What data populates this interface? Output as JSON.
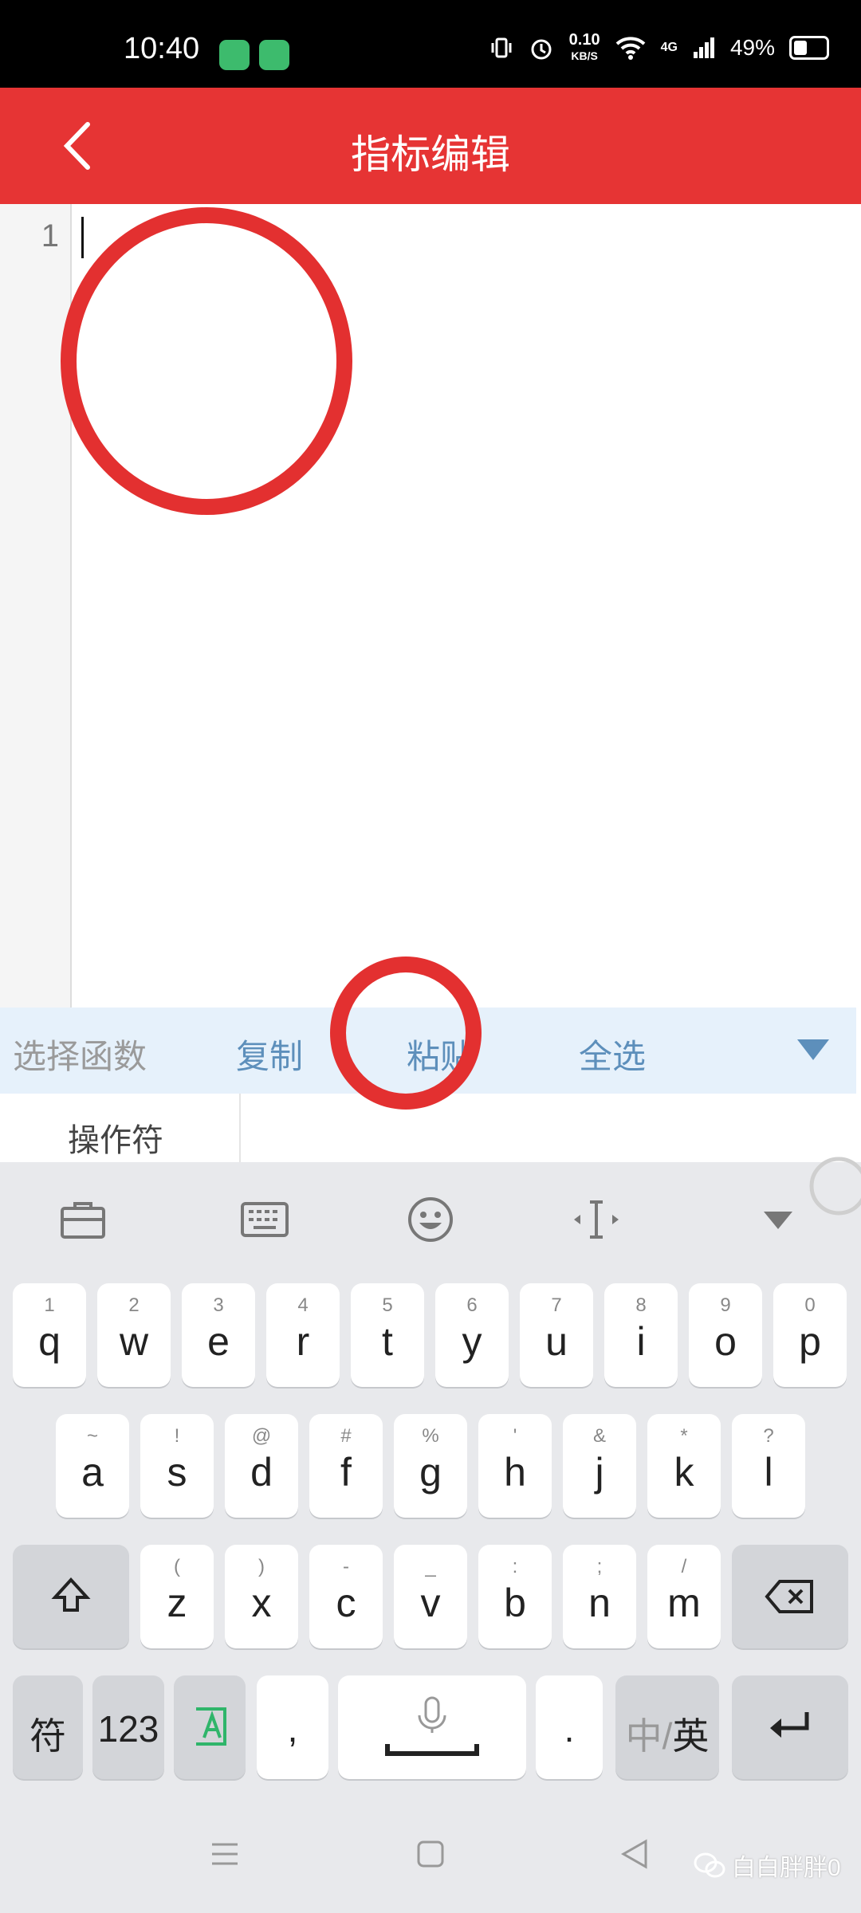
{
  "status_bar": {
    "time": "10:40",
    "speed_value": "0.10",
    "speed_unit": "KB/S",
    "network": "4G",
    "battery": "49%"
  },
  "header": {
    "title": "指标编辑"
  },
  "editor": {
    "line_number": "1"
  },
  "toolbar": {
    "select_function": "选择函数",
    "copy": "复制",
    "paste": "粘贴",
    "select_all": "全选"
  },
  "operator_tab": {
    "label": "操作符"
  },
  "keyboard": {
    "row1": [
      {
        "main": "q",
        "sub": "1"
      },
      {
        "main": "w",
        "sub": "2"
      },
      {
        "main": "e",
        "sub": "3"
      },
      {
        "main": "r",
        "sub": "4"
      },
      {
        "main": "t",
        "sub": "5"
      },
      {
        "main": "y",
        "sub": "6"
      },
      {
        "main": "u",
        "sub": "7"
      },
      {
        "main": "i",
        "sub": "8"
      },
      {
        "main": "o",
        "sub": "9"
      },
      {
        "main": "p",
        "sub": "0"
      }
    ],
    "row2": [
      {
        "main": "a",
        "sub": "~"
      },
      {
        "main": "s",
        "sub": "!"
      },
      {
        "main": "d",
        "sub": "@"
      },
      {
        "main": "f",
        "sub": "#"
      },
      {
        "main": "g",
        "sub": "%"
      },
      {
        "main": "h",
        "sub": "'"
      },
      {
        "main": "j",
        "sub": "&"
      },
      {
        "main": "k",
        "sub": "*"
      },
      {
        "main": "l",
        "sub": "?"
      }
    ],
    "row3": [
      {
        "main": "z",
        "sub": "("
      },
      {
        "main": "x",
        "sub": ")"
      },
      {
        "main": "c",
        "sub": "-"
      },
      {
        "main": "v",
        "sub": "_"
      },
      {
        "main": "b",
        "sub": ":"
      },
      {
        "main": "n",
        "sub": ";"
      },
      {
        "main": "m",
        "sub": "/"
      }
    ],
    "symbol_key": "符",
    "numbers_key": "123",
    "comma_key": ",",
    "period_key": ".",
    "lang_key_zh": "中",
    "lang_key_sep": "/",
    "lang_key_en": "英"
  },
  "watermark": {
    "text": "白白胖胖0"
  },
  "colors": {
    "header_red": "#e63434",
    "toolbar_blue": "#5d8fbb",
    "annotation_red": "#e33030"
  }
}
